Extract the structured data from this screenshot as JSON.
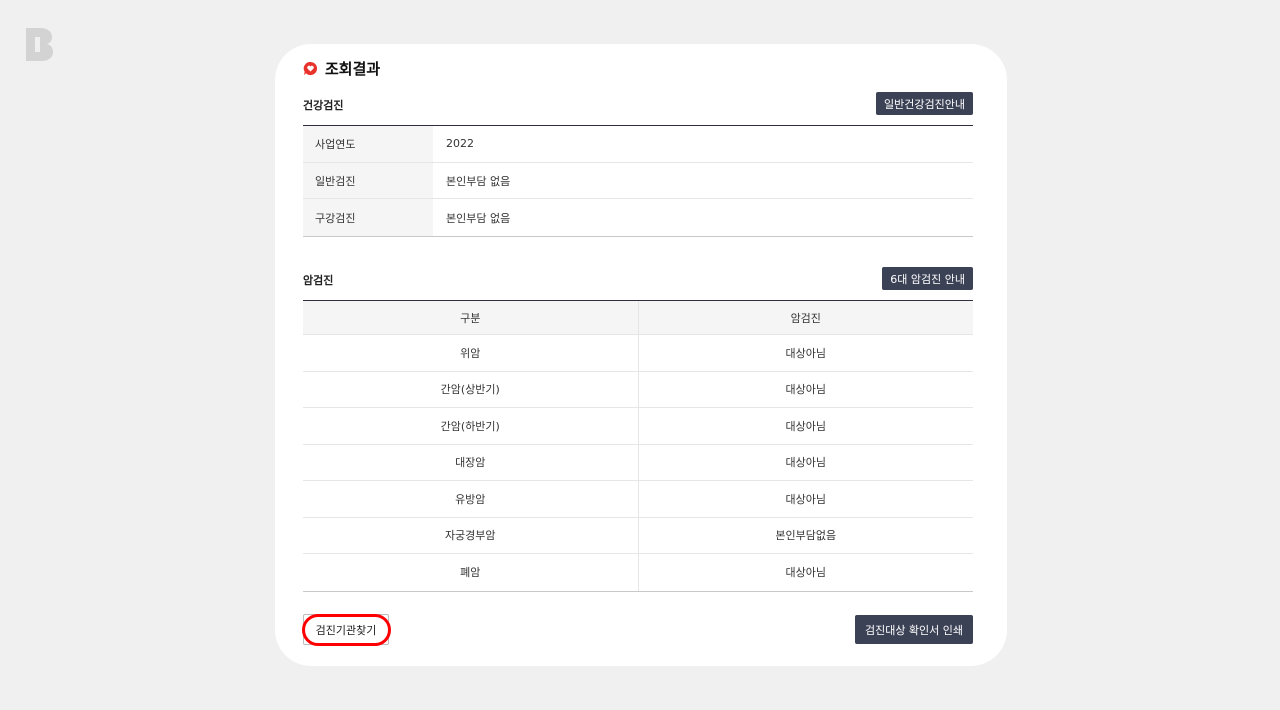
{
  "colors": {
    "background": "#f0f0f0",
    "card": "#ffffff",
    "button_dark": "#3c4256",
    "header_border": "#2d2f3f",
    "label_bg": "#f5f5f5",
    "highlight": "#ff0000",
    "title_icon": "#e8322b"
  },
  "logo_icon": "b-logo-icon",
  "result": {
    "title": "조회결과",
    "icon": "heart-speech-bubble-icon"
  },
  "health": {
    "section_label": "건강검진",
    "guide_button": "일반건강검진안내",
    "rows": [
      {
        "label": "사업연도",
        "value": "2022"
      },
      {
        "label": "일반검진",
        "value": "본인부담 없음"
      },
      {
        "label": "구강검진",
        "value": "본인부담 없음"
      }
    ]
  },
  "cancer": {
    "section_label": "암검진",
    "guide_button": "6대 암검진 안내",
    "headers": [
      "구분",
      "암검진"
    ],
    "rows": [
      {
        "type": "위암",
        "status": "대상아님"
      },
      {
        "type": "간암(상반기)",
        "status": "대상아님"
      },
      {
        "type": "간암(하반기)",
        "status": "대상아님"
      },
      {
        "type": "대장암",
        "status": "대상아님"
      },
      {
        "type": "유방암",
        "status": "대상아님"
      },
      {
        "type": "자궁경부암",
        "status": "본인부담없음"
      },
      {
        "type": "폐암",
        "status": "대상아님"
      }
    ]
  },
  "actions": {
    "find_institution": "검진기관찾기",
    "print_confirmation": "검진대상 확인서 인쇄"
  }
}
